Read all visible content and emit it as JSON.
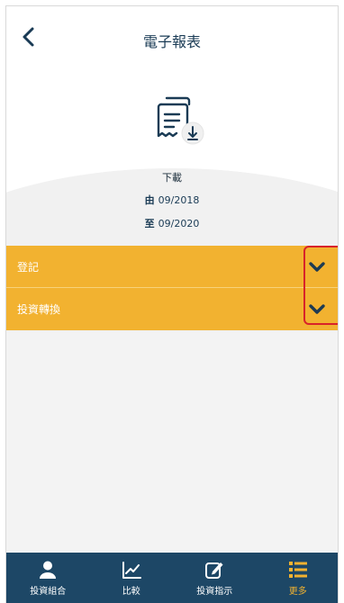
{
  "header": {
    "title": "電子報表"
  },
  "hero": {
    "download_label": "下載",
    "from_prefix": "由",
    "from_date": "09/2018",
    "to_prefix": "至",
    "to_date": "09/2020"
  },
  "accordion": {
    "items": [
      {
        "label": "登記"
      },
      {
        "label": "投資轉換"
      }
    ]
  },
  "nav": {
    "items": [
      {
        "label": "投資組合",
        "icon": "person-icon"
      },
      {
        "label": "比較",
        "icon": "chart-icon"
      },
      {
        "label": "投資指示",
        "icon": "edit-icon"
      },
      {
        "label": "更多",
        "icon": "menu-list-icon"
      }
    ],
    "active_index": 3
  },
  "colors": {
    "accent": "#f2b230",
    "nav_bg": "#1d4766",
    "title": "#1a3b55",
    "highlight": "#d8232a"
  }
}
